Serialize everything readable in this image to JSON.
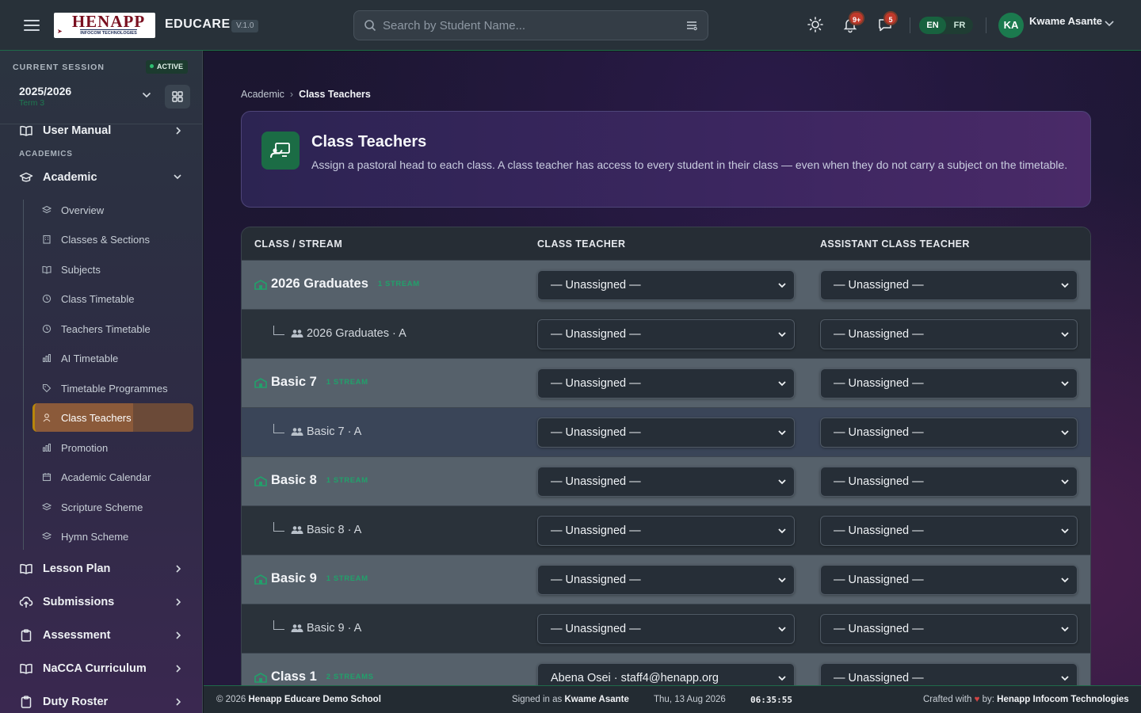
{
  "app": {
    "logo_main": "HENAPP",
    "logo_sub": "INFOCOM TECHNOLOGIES",
    "brand": "EDUCARE",
    "version": "V.1.0"
  },
  "topbar": {
    "search_placeholder": "Search by Student Name...",
    "notifications_badge": "9+",
    "messages_badge": "5",
    "lang_en": "EN",
    "lang_fr": "FR",
    "avatar_initials": "KA",
    "user_name": "Kwame Asante"
  },
  "sidebar": {
    "session_label": "CURRENT SESSION",
    "session_status": "ACTIVE",
    "session_year": "2025/2026",
    "session_term": "Term 3",
    "user_manual": "User Manual",
    "academics_heading": "ACADEMICS",
    "academic": "Academic",
    "sub_items": [
      "Overview",
      "Classes & Sections",
      "Subjects",
      "Class Timetable",
      "Teachers Timetable",
      "AI Timetable",
      "Timetable Programmes",
      "Class Teachers",
      "Promotion",
      "Academic Calendar",
      "Scripture Scheme",
      "Hymn Scheme"
    ],
    "lesson_plan": "Lesson Plan",
    "submissions": "Submissions",
    "assessment": "Assessment",
    "nacca": "NaCCA Curriculum",
    "duty_roster": "Duty Roster"
  },
  "breadcrumb": {
    "parent": "Academic",
    "current": "Class Teachers"
  },
  "hero": {
    "title": "Class Teachers",
    "description": "Assign a pastoral head to each class. A class teacher has access to every student in their class — even when they do not carry a subject on the timetable."
  },
  "table": {
    "headers": [
      "CLASS / STREAM",
      "CLASS TEACHER",
      "ASSISTANT CLASS TEACHER"
    ],
    "rows": [
      {
        "kind": "group",
        "name": "2026 Graduates",
        "streams": "1 STREAM",
        "teacher": "— Unassigned —",
        "assistant": "— Unassigned —"
      },
      {
        "kind": "sub",
        "name": "2026 Graduates · A",
        "teacher": "— Unassigned —",
        "assistant": "— Unassigned —"
      },
      {
        "kind": "group",
        "name": "Basic 7",
        "streams": "1 STREAM",
        "teacher": "— Unassigned —",
        "assistant": "— Unassigned —"
      },
      {
        "kind": "sub",
        "name": "Basic 7 · A",
        "teacher": "— Unassigned —",
        "assistant": "— Unassigned —"
      },
      {
        "kind": "group",
        "name": "Basic 8",
        "streams": "1 STREAM",
        "teacher": "— Unassigned —",
        "assistant": "— Unassigned —"
      },
      {
        "kind": "sub",
        "name": "Basic 8 · A",
        "teacher": "— Unassigned —",
        "assistant": "— Unassigned —"
      },
      {
        "kind": "group",
        "name": "Basic 9",
        "streams": "1 STREAM",
        "teacher": "— Unassigned —",
        "assistant": "— Unassigned —"
      },
      {
        "kind": "sub",
        "name": "Basic 9 · A",
        "teacher": "— Unassigned —",
        "assistant": "— Unassigned —"
      },
      {
        "kind": "group",
        "name": "Class 1",
        "streams": "2 STREAMS",
        "teacher": "Abena Osei · staff4@henapp.org",
        "assistant": "— Unassigned —"
      }
    ]
  },
  "footer": {
    "copyright_prefix": "© 2026",
    "school": "Henapp Educare Demo School",
    "signed_prefix": "Signed in as",
    "signed_user": "Kwame Asante",
    "date": "Thu, 13 Aug 2026",
    "time": "06:35:55",
    "crafted_prefix": "Crafted with",
    "crafted_by": "by:",
    "company": "Henapp Infocom Technologies"
  },
  "colors": {
    "accent_green": "#1b7a4e",
    "active_nav": "#8b5a3a",
    "badge_red": "#c0392b"
  }
}
